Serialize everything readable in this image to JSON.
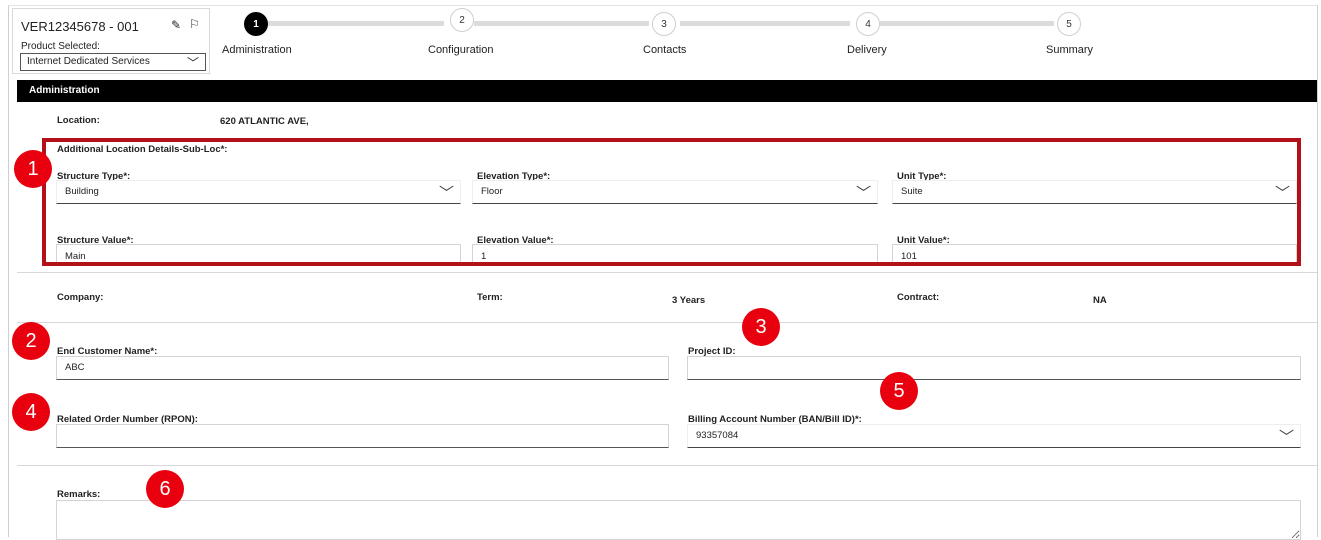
{
  "order": {
    "id": "VER12345678 - 001",
    "product_label": "Product Selected:",
    "product_value": "Internet Dedicated Services"
  },
  "steps": [
    {
      "number": "1",
      "label": "Administration"
    },
    {
      "number": "2",
      "label": "Configuration"
    },
    {
      "number": "3",
      "label": "Contacts"
    },
    {
      "number": "4",
      "label": "Delivery"
    },
    {
      "number": "5",
      "label": "Summary"
    }
  ],
  "section_title": "Administration",
  "location": {
    "label": "Location:",
    "value": "620 ATLANTIC AVE,"
  },
  "sub_loc": {
    "title": "Additional Location Details-Sub-Loc*:",
    "structure_type": {
      "label": "Structure Type*:",
      "value": "Building"
    },
    "elevation_type": {
      "label": "Elevation Type*:",
      "value": "Floor"
    },
    "unit_type": {
      "label": "Unit Type*:",
      "value": "Suite"
    },
    "structure_value": {
      "label": "Structure Value*:",
      "value": "Main"
    },
    "elevation_value": {
      "label": "Elevation Value*:",
      "value": "1"
    },
    "unit_value": {
      "label": "Unit Value*:",
      "value": "101"
    }
  },
  "company": {
    "label": "Company:",
    "value": ""
  },
  "term": {
    "label": "Term:",
    "value": "3 Years"
  },
  "contract": {
    "label": "Contract:",
    "value": "NA"
  },
  "end_customer": {
    "label": "End Customer Name*:",
    "value": "ABC"
  },
  "project_id": {
    "label": "Project ID:",
    "value": ""
  },
  "related_order": {
    "label": "Related Order Number (RPON):",
    "value": ""
  },
  "billing_account": {
    "label": "Billing Account Number (BAN/Bill ID)*:",
    "value": "93357084"
  },
  "remarks": {
    "label": "Remarks:",
    "value": ""
  },
  "badges": [
    "1",
    "2",
    "3",
    "4",
    "5",
    "6"
  ],
  "colors": {
    "badge": "#e8000f",
    "highlight": "#b3101a",
    "header": "#000000"
  }
}
